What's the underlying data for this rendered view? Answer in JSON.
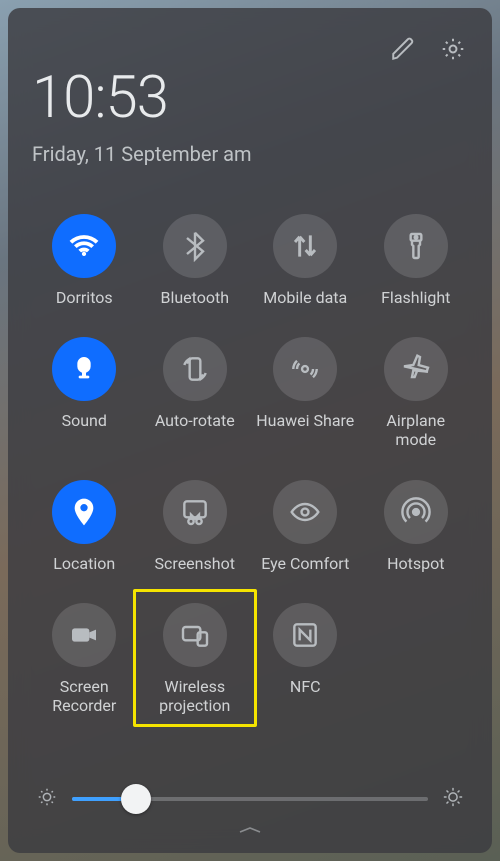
{
  "time": "10:53",
  "date": "Friday, 11 September  am",
  "tiles": [
    {
      "id": "wifi",
      "label": "Dorritos",
      "active": true
    },
    {
      "id": "bluetooth",
      "label": "Bluetooth",
      "active": false
    },
    {
      "id": "mobiledata",
      "label": "Mobile data",
      "active": false
    },
    {
      "id": "flashlight",
      "label": "Flashlight",
      "active": false
    },
    {
      "id": "sound",
      "label": "Sound",
      "active": true
    },
    {
      "id": "autorotate",
      "label": "Auto-rotate",
      "active": false
    },
    {
      "id": "huaweishare",
      "label": "Huawei Share",
      "active": false
    },
    {
      "id": "airplane",
      "label": "Airplane\nmode",
      "active": false
    },
    {
      "id": "location",
      "label": "Location",
      "active": true
    },
    {
      "id": "screenshot",
      "label": "Screenshot",
      "active": false
    },
    {
      "id": "eyecomfort",
      "label": "Eye Comfort",
      "active": false
    },
    {
      "id": "hotspot",
      "label": "Hotspot",
      "active": false
    },
    {
      "id": "screenrec",
      "label": "Screen\nRecorder",
      "active": false
    },
    {
      "id": "wireless",
      "label": "Wireless\nprojection",
      "active": false
    },
    {
      "id": "nfc",
      "label": "NFC",
      "active": false
    }
  ],
  "brightness": {
    "percent": 18
  },
  "highlight_tile_index": 13
}
